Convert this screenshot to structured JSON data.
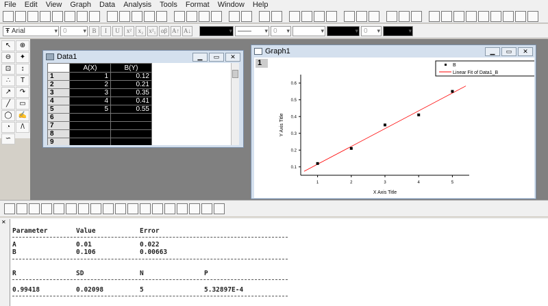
{
  "menu": [
    "File",
    "Edit",
    "View",
    "Graph",
    "Data",
    "Analysis",
    "Tools",
    "Format",
    "Window",
    "Help"
  ],
  "format_toolbar": {
    "font": "Arial",
    "font_size": "0",
    "buttons": [
      "B",
      "I",
      "U",
      "x²",
      "x₂",
      "x²₁",
      "αβ",
      "A↑",
      "A↓"
    ],
    "line_width": "0",
    "pattern": "0"
  },
  "data_window": {
    "title": "Data1",
    "columns": [
      "A(X)",
      "B(Y)"
    ],
    "rows": [
      [
        "1",
        "1",
        "0.12"
      ],
      [
        "2",
        "2",
        "0.21"
      ],
      [
        "3",
        "3",
        "0.35"
      ],
      [
        "4",
        "4",
        "0.41"
      ],
      [
        "5",
        "5",
        "0.55"
      ],
      [
        "6",
        "",
        ""
      ],
      [
        "7",
        "",
        ""
      ],
      [
        "8",
        "",
        ""
      ],
      [
        "9",
        "",
        ""
      ]
    ]
  },
  "graph_window": {
    "title": "Graph1",
    "layer": "1"
  },
  "chart_data": {
    "type": "scatter",
    "xlabel": "X Axis Title",
    "ylabel": "Y Axis Title",
    "xlim": [
      0.5,
      5.5
    ],
    "ylim": [
      0.05,
      0.65
    ],
    "xticks": [
      "1",
      "2",
      "3",
      "4",
      "5"
    ],
    "yticks": [
      "0.1",
      "0.2",
      "0.3",
      "0.4",
      "0.5",
      "0.6"
    ],
    "legend_position": "top-right",
    "series": [
      {
        "name": "B",
        "type": "scatter",
        "color": "#000000",
        "x": [
          1,
          2,
          3,
          4,
          5
        ],
        "y": [
          0.12,
          0.21,
          0.35,
          0.41,
          0.55
        ]
      },
      {
        "name": "Linear Fit of Data1_B",
        "type": "line",
        "color": "#ff0000",
        "intercept": 0.01,
        "slope": 0.106,
        "x_range": [
          0.6,
          5.4
        ]
      }
    ]
  },
  "results": {
    "header1": [
      "Parameter",
      "Value",
      "Error"
    ],
    "params": [
      [
        "A",
        "0.01",
        "0.022"
      ],
      [
        "B",
        "0.106",
        "0.00663"
      ]
    ],
    "header2": [
      "R",
      "SD",
      "N",
      "P"
    ],
    "stats": [
      "0.99418",
      "0.02098",
      "5",
      "5.32897E-4"
    ]
  }
}
